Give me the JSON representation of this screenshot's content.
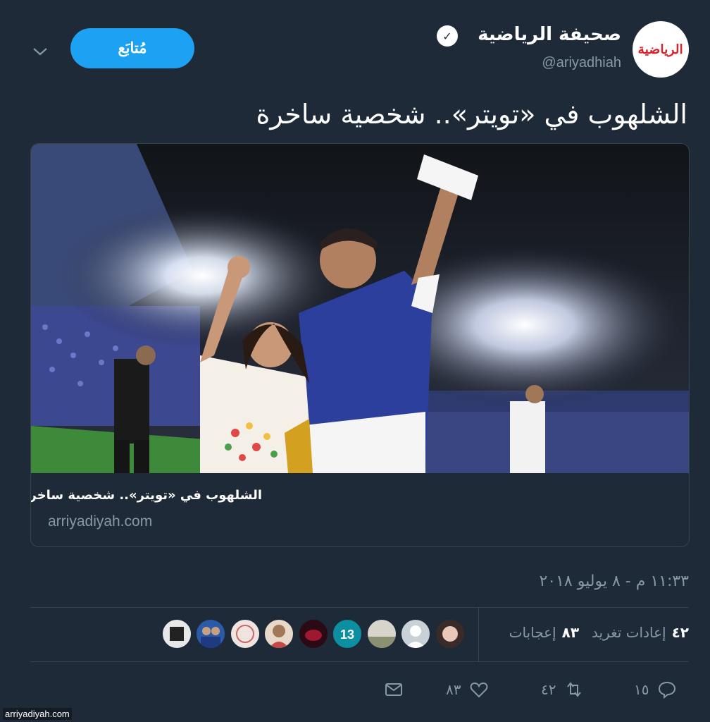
{
  "header": {
    "avatar_logo": "الرياضية",
    "display_name": "صحيفة الرياضية",
    "handle": "@ariyadhiah",
    "follow_label": "مُتابَع"
  },
  "tweet": {
    "text": "الشلهوب في «تويتر».. شخصية ساخرة"
  },
  "card": {
    "title": "الشلهوب في «تويتر».. شخصية ساخرة",
    "domain": "arriyadiyah.com"
  },
  "timestamp": "١١:٣٣ م - ٨ يوليو ٢٠١٨",
  "stats": {
    "retweets_count": "٤٢",
    "retweets_label": "إعادات تغريد",
    "likes_count": "٨٣",
    "likes_label": "إعجابات"
  },
  "actions": {
    "reply_count": "١٥",
    "retweet_count": "٤٢",
    "like_count": "٨٣"
  },
  "watermark": "arriyadiyah.com",
  "colors": {
    "background": "#1f2a38",
    "accent": "#1da1f2",
    "muted": "#8899a6",
    "border": "#38444d"
  }
}
